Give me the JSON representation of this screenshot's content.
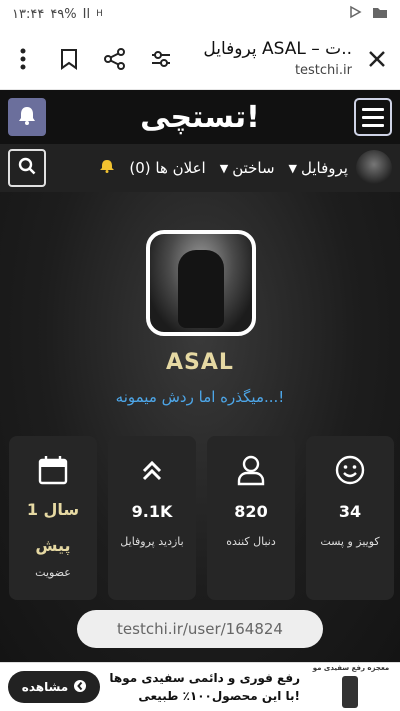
{
  "status_bar": {
    "time": "۱۳:۴۴",
    "battery": "۴۹%",
    "signal": "Il",
    "network": "H"
  },
  "browser": {
    "page_title": "پروفایل ASAL – ت..",
    "url": "testchi.ir"
  },
  "site": {
    "logo": "تستچی!"
  },
  "nav": {
    "profile": "پروفایل",
    "create": "ساختن",
    "notifications": "اعلان ها (0)"
  },
  "profile": {
    "username": "ASAL",
    "bio": "میگذره اما ردش میمونه...!",
    "stats": [
      {
        "label": "کوییز و پست",
        "value": "34",
        "icon": "smiley-icon"
      },
      {
        "label": "دنبال کننده",
        "value": "820",
        "icon": "user-icon"
      },
      {
        "label": "بازدید پروفایل",
        "value": "9.1K",
        "icon": "double-chevron-up-icon"
      },
      {
        "label": "عضویت",
        "value_line1": "1 سال",
        "value_line2": "پیش",
        "icon": "calendar-icon"
      }
    ],
    "profile_url": "testchi.ir/user/164824"
  },
  "ad": {
    "line1": "رفع فوری و دائمی سفیدی موها",
    "line2": "با این محصول۱۰۰٪ طبیعی!",
    "button": "مشاهده",
    "brand": "معجزه رفع سفیدی مو"
  },
  "colors": {
    "accent_gold": "#e6d9a3",
    "bio_blue": "#4da6e8",
    "bell_bg": "#6b6f9c"
  }
}
